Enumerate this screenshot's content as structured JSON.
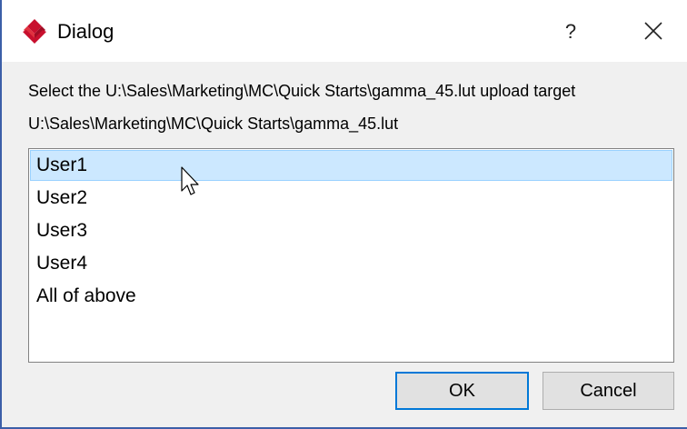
{
  "window": {
    "title": "Dialog",
    "help_glyph": "?",
    "icons": {
      "app": "red-diamond-logo-icon",
      "close": "close-icon"
    }
  },
  "dialog": {
    "prompt": "Select the U:\\Sales\\Marketing\\MC\\Quick Starts\\gamma_45.lut upload target",
    "file_path": "U:\\Sales\\Marketing\\MC\\Quick Starts\\gamma_45.lut"
  },
  "list": {
    "items": [
      "User1",
      "User2",
      "User3",
      "User4",
      "All of above"
    ],
    "selected_index": 0,
    "selection_color": "#cce8ff"
  },
  "buttons": {
    "ok_label": "OK",
    "cancel_label": "Cancel"
  },
  "colors": {
    "accent": "#0078d7",
    "brand": "#c8102e"
  }
}
